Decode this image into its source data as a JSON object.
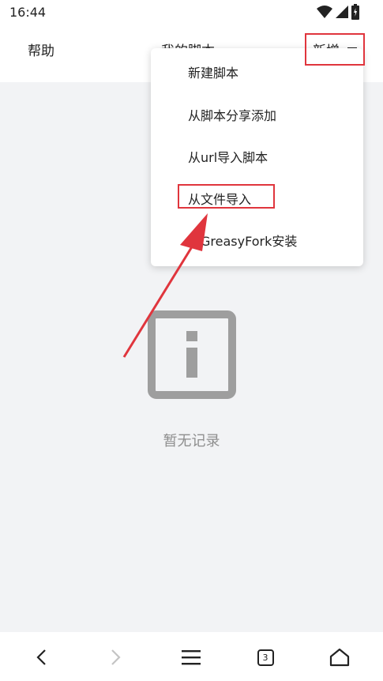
{
  "status": {
    "time": "16:44"
  },
  "header": {
    "help": "帮助",
    "title": "我的脚本",
    "add": "新增"
  },
  "menu": {
    "items": [
      {
        "label": "新建脚本"
      },
      {
        "label": "从脚本分享添加"
      },
      {
        "label": "从url导入脚本"
      },
      {
        "label": "从文件导入"
      },
      {
        "label": "从GreasyFork安装"
      }
    ]
  },
  "empty": {
    "icon": "info-icon",
    "text": "暂无记录"
  },
  "nav": {
    "tab_count": "3"
  },
  "colors": {
    "highlight": "#e0353d",
    "icon_gray": "#9e9e9e",
    "text_gray": "#8e8e8e"
  },
  "icons": [
    "wifi-icon",
    "signal-icon",
    "battery-icon",
    "minus-icon",
    "back-icon",
    "forward-icon",
    "menu-icon",
    "tabs-icon",
    "home-icon"
  ]
}
